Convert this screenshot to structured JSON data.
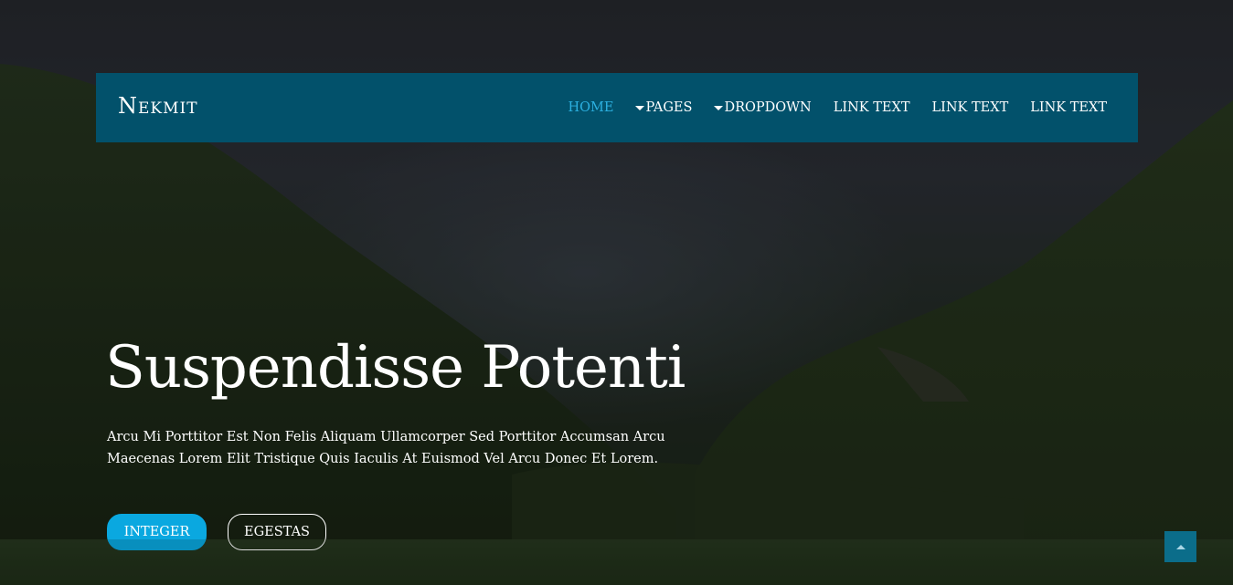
{
  "brand": {
    "name": "Nekmit"
  },
  "nav": {
    "items": [
      {
        "label": "HOME",
        "active": true,
        "dropdown": false
      },
      {
        "label": "PAGES",
        "active": false,
        "dropdown": true
      },
      {
        "label": "DROPDOWN",
        "active": false,
        "dropdown": true
      },
      {
        "label": "LINK TEXT",
        "active": false,
        "dropdown": false
      },
      {
        "label": "LINK TEXT",
        "active": false,
        "dropdown": false
      },
      {
        "label": "LINK TEXT",
        "active": false,
        "dropdown": false
      }
    ]
  },
  "hero": {
    "headline": "Suspendisse Potenti",
    "lead": "Arcu Mi Porttitor Est Non Felis Aliquam Ullamcorper Sed Porttitor Accumsan Arcu Maecenas Lorem Elit Tristique Quis Iaculis At Euismod Vel Arcu Donec Et Lorem.",
    "primary_button": "INTEGER",
    "secondary_button": "EGESTAS"
  },
  "scroll_top": {
    "icon": "caret-up-icon"
  },
  "colors": {
    "navbar_bg": "#02516b",
    "nav_active": "#2cb0e0",
    "primary_button": "#0aa8e0",
    "scroll_top_bg": "#0b6d8a"
  }
}
